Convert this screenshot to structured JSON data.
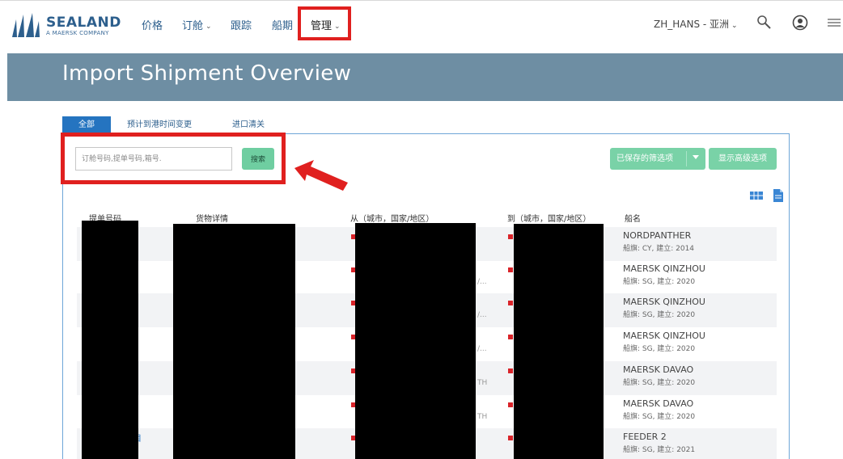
{
  "brand": {
    "name": "SEALAND",
    "tagline": "A MAERSK COMPANY",
    "colors": {
      "brand_blue": "#2d5f8d",
      "banner": "#6e8ea3",
      "accent_green": "#79d2a7",
      "tab_blue": "#2574c0",
      "highlight_red": "#e0201f"
    }
  },
  "nav": {
    "prices": "价格",
    "booking": "订舱",
    "tracking": "跟踪",
    "schedules": "船期",
    "manage": "管理",
    "language": "ZH_HANS - 亚洲",
    "icons": [
      "search-icon",
      "user-icon",
      "menu-icon"
    ]
  },
  "page": {
    "title": "Import Shipment Overview"
  },
  "tabs": {
    "all": "全部",
    "eta_changes": "预计到港时间变更",
    "import_clearance": "进口清关"
  },
  "search": {
    "placeholder": "订舱号码,提单号码,箱号.",
    "button": "搜索"
  },
  "filters": {
    "saved": "已保存的筛选项",
    "advanced": "显示高级选项"
  },
  "table": {
    "headers": {
      "bl_number": "提单号码",
      "cargo_details": "货物详情",
      "from": "从（城市，国家/地区）",
      "to": "到（城市，国家/地区）",
      "vessel": "船名"
    },
    "rows": [
      {
        "vessel": "NORDPANTHER",
        "meta": "船旗: CY, 建立: 2014",
        "frag": ""
      },
      {
        "vessel": "MAERSK QINZHOU",
        "meta": "船旗: SG, 建立: 2020",
        "frag": "/..."
      },
      {
        "vessel": "MAERSK QINZHOU",
        "meta": "船旗: SG, 建立: 2020",
        "frag": "/..."
      },
      {
        "vessel": "MAERSK QINZHOU",
        "meta": "船旗: SG, 建立: 2020",
        "frag": "/..."
      },
      {
        "vessel": "MAERSK DAVAO",
        "meta": "船旗: SG, 建立: 2020",
        "frag": "TH"
      },
      {
        "vessel": "MAERSK DAVAO",
        "meta": "船旗: SG, 建立: 2020",
        "frag": "TH"
      },
      {
        "vessel": "FEEDER 2",
        "meta": "船旗: SG, 建立: 2021",
        "frag": ""
      }
    ],
    "bl_fragment": "目"
  }
}
